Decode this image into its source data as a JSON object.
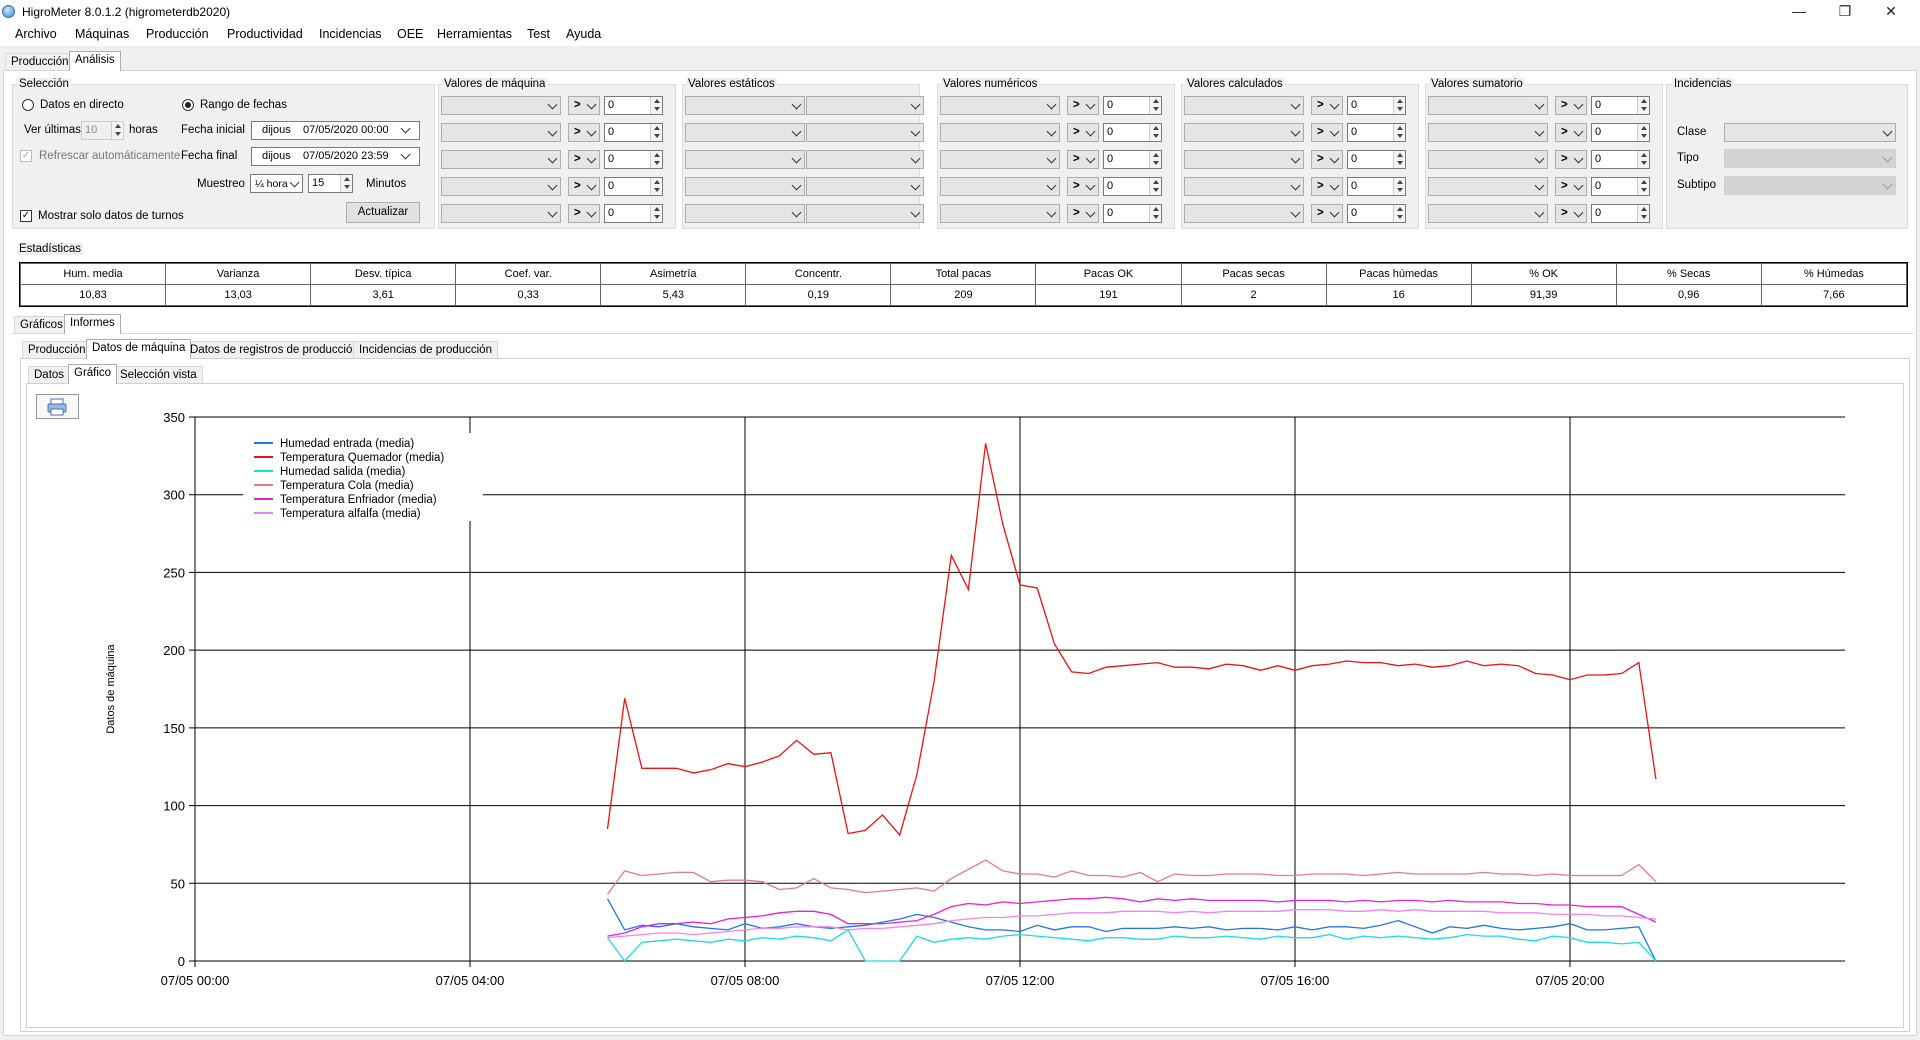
{
  "window": {
    "title": "HigroMeter 8.0.1.2 (higrometerdb2020)",
    "min": "—",
    "max": "❐",
    "close": "✕"
  },
  "menu": [
    "Archivo",
    "Máquinas",
    "Producción",
    "Productividad",
    "Incidencias",
    "OEE",
    "Herramientas",
    "Test",
    "Ayuda"
  ],
  "top_tabs": [
    "Producción",
    "Análisis"
  ],
  "seleccion": {
    "title": "Selección",
    "radio_directo": "Datos en directo",
    "radio_rango": "Rango de fechas",
    "ver_ultimas": "Ver últimas",
    "ver_ultimas_value": "10",
    "horas": "horas",
    "refrescar": "Refrescar automáticamente",
    "fecha_inicial_label": "Fecha inicial",
    "fecha_inicial_day": "dijous",
    "fecha_inicial_value": "07/05/2020 00:00",
    "fecha_final_label": "Fecha final",
    "fecha_final_day": "dijous",
    "fecha_final_value": "07/05/2020 23:59",
    "muestreo_label": "Muestreo",
    "muestreo_value": "¼ hora",
    "minutos_value": "15",
    "minutos_label": "Minutos",
    "actualizar": "Actualizar",
    "mostrar_turnos": "Mostrar solo datos de turnos"
  },
  "groups": [
    {
      "title": "Valores de máquina",
      "type": "cmp"
    },
    {
      "title": "Valores estáticos",
      "type": "static"
    },
    {
      "title": "Valores numéricos",
      "type": "cmp"
    },
    {
      "title": "Valores calculados",
      "type": "cmp"
    },
    {
      "title": "Valores sumatorio",
      "type": "cmp"
    }
  ],
  "filter_op": ">",
  "filter_value": "0",
  "incidencias": {
    "title": "Incidencias",
    "clase": "Clase",
    "tipo": "Tipo",
    "subtipo": "Subtipo"
  },
  "estadisticas": {
    "title": "Estadísticas",
    "headers": [
      "Hum. media",
      "Varianza",
      "Desv. típica",
      "Coef. var.",
      "Asimetría",
      "Concentr.",
      "Total pacas",
      "Pacas OK",
      "Pacas secas",
      "Pacas húmedas",
      "% OK",
      "% Secas",
      "% Húmedas"
    ],
    "values": [
      "10,83",
      "13,03",
      "3,61",
      "0,33",
      "5,43",
      "0,19",
      "209",
      "191",
      "2",
      "16",
      "91,39",
      "0,96",
      "7,66"
    ]
  },
  "tabs_level1": [
    "Gráficos",
    "Informes"
  ],
  "tabs_level2": [
    "Producción",
    "Datos de máquina",
    "Datos de registros de producción",
    "Incidencias de producción"
  ],
  "tabs_level3": [
    "Datos",
    "Gráfico",
    "Selección vista"
  ],
  "print_icon": "printer-icon",
  "chart_data": {
    "type": "line",
    "ylabel": "Datos de máquina",
    "ylim": [
      0,
      350
    ],
    "yticks": [
      "0",
      "50",
      "100",
      "150",
      "200",
      "250",
      "300",
      "350"
    ],
    "xticks": [
      "07/05 00:00",
      "07/05 04:00",
      "07/05 08:00",
      "07/05 12:00",
      "07/05 16:00",
      "07/05 20:00"
    ],
    "x_start": "06:00",
    "x_step_minutes": 15,
    "grid": true,
    "legend_position": "top-left",
    "series": [
      {
        "name": "Humedad entrada (media)",
        "color": "#1f77e6",
        "values": [
          40,
          20,
          23,
          22,
          24,
          22,
          21,
          20,
          24,
          21,
          22,
          24,
          22,
          21,
          22,
          23,
          25,
          27,
          30,
          28,
          25,
          22,
          20,
          20,
          19,
          23,
          20,
          22,
          22,
          19,
          21,
          21,
          21,
          22,
          21,
          22,
          20,
          21,
          21,
          20,
          22,
          20,
          22,
          22,
          21,
          23,
          26,
          22,
          18,
          22,
          21,
          23,
          21,
          20,
          21,
          22,
          24,
          20,
          20,
          21,
          22,
          0
        ]
      },
      {
        "name": "Temperatura Quemador (media)",
        "color": "#ee1111",
        "values": [
          85,
          169,
          124,
          124,
          124,
          121,
          123,
          127,
          125,
          128,
          132,
          142,
          133,
          134,
          82,
          84,
          94,
          81,
          120,
          180,
          261,
          239,
          333,
          281,
          242,
          240,
          204,
          186,
          185,
          189,
          190,
          191,
          192,
          189,
          189,
          188,
          191,
          190,
          187,
          190,
          187,
          190,
          191,
          193,
          192,
          192,
          190,
          191,
          189,
          190,
          193,
          190,
          191,
          190,
          185,
          184,
          181,
          184,
          184,
          185,
          192,
          117
        ]
      },
      {
        "name": "Humedad salida (media)",
        "color": "#19dde6",
        "values": [
          15,
          0,
          12,
          13,
          14,
          13,
          12,
          14,
          13,
          15,
          14,
          16,
          15,
          13,
          20,
          0,
          0,
          0,
          16,
          12,
          14,
          15,
          14,
          16,
          17,
          16,
          15,
          14,
          13,
          15,
          15,
          14,
          14,
          16,
          15,
          15,
          16,
          15,
          14,
          16,
          15,
          15,
          17,
          14,
          16,
          15,
          16,
          15,
          14,
          15,
          17,
          16,
          16,
          14,
          13,
          16,
          15,
          12,
          12,
          11,
          12,
          0
        ]
      },
      {
        "name": "Temperatura Cola (media)",
        "color": "#e57b87",
        "values": [
          43,
          58,
          55,
          56,
          57,
          57,
          51,
          52,
          52,
          51,
          46,
          47,
          53,
          47,
          46,
          44,
          45,
          46,
          47,
          45,
          53,
          59,
          65,
          58,
          56,
          56,
          54,
          58,
          55,
          55,
          54,
          57,
          51,
          56,
          55,
          55,
          56,
          56,
          56,
          55,
          55,
          56,
          56,
          56,
          55,
          56,
          57,
          56,
          56,
          56,
          56,
          57,
          56,
          56,
          55,
          56,
          55,
          55,
          55,
          55,
          62,
          51
        ]
      },
      {
        "name": "Temperatura Enfriador (media)",
        "color": "#e61fe0",
        "values": [
          16,
          18,
          22,
          24,
          24,
          25,
          24,
          27,
          28,
          29,
          31,
          32,
          32,
          30,
          24,
          24,
          24,
          25,
          26,
          30,
          35,
          37,
          36,
          38,
          37,
          38,
          39,
          40,
          40,
          41,
          40,
          38,
          40,
          39,
          40,
          39,
          39,
          39,
          39,
          38,
          39,
          39,
          39,
          38,
          39,
          38,
          39,
          39,
          38,
          39,
          38,
          38,
          38,
          37,
          37,
          36,
          36,
          35,
          35,
          35,
          30,
          25
        ]
      },
      {
        "name": "Temperatura alfalfa (media)",
        "color": "#f084ef",
        "values": [
          15,
          16,
          17,
          18,
          18,
          17,
          18,
          19,
          20,
          21,
          21,
          22,
          22,
          22,
          20,
          21,
          21,
          22,
          23,
          24,
          26,
          27,
          28,
          28,
          29,
          29,
          30,
          31,
          31,
          31,
          32,
          32,
          32,
          31,
          32,
          31,
          32,
          32,
          32,
          32,
          33,
          33,
          33,
          32,
          32,
          33,
          32,
          33,
          32,
          32,
          32,
          32,
          31,
          31,
          31,
          30,
          30,
          30,
          29,
          29,
          28,
          27
        ]
      }
    ]
  }
}
